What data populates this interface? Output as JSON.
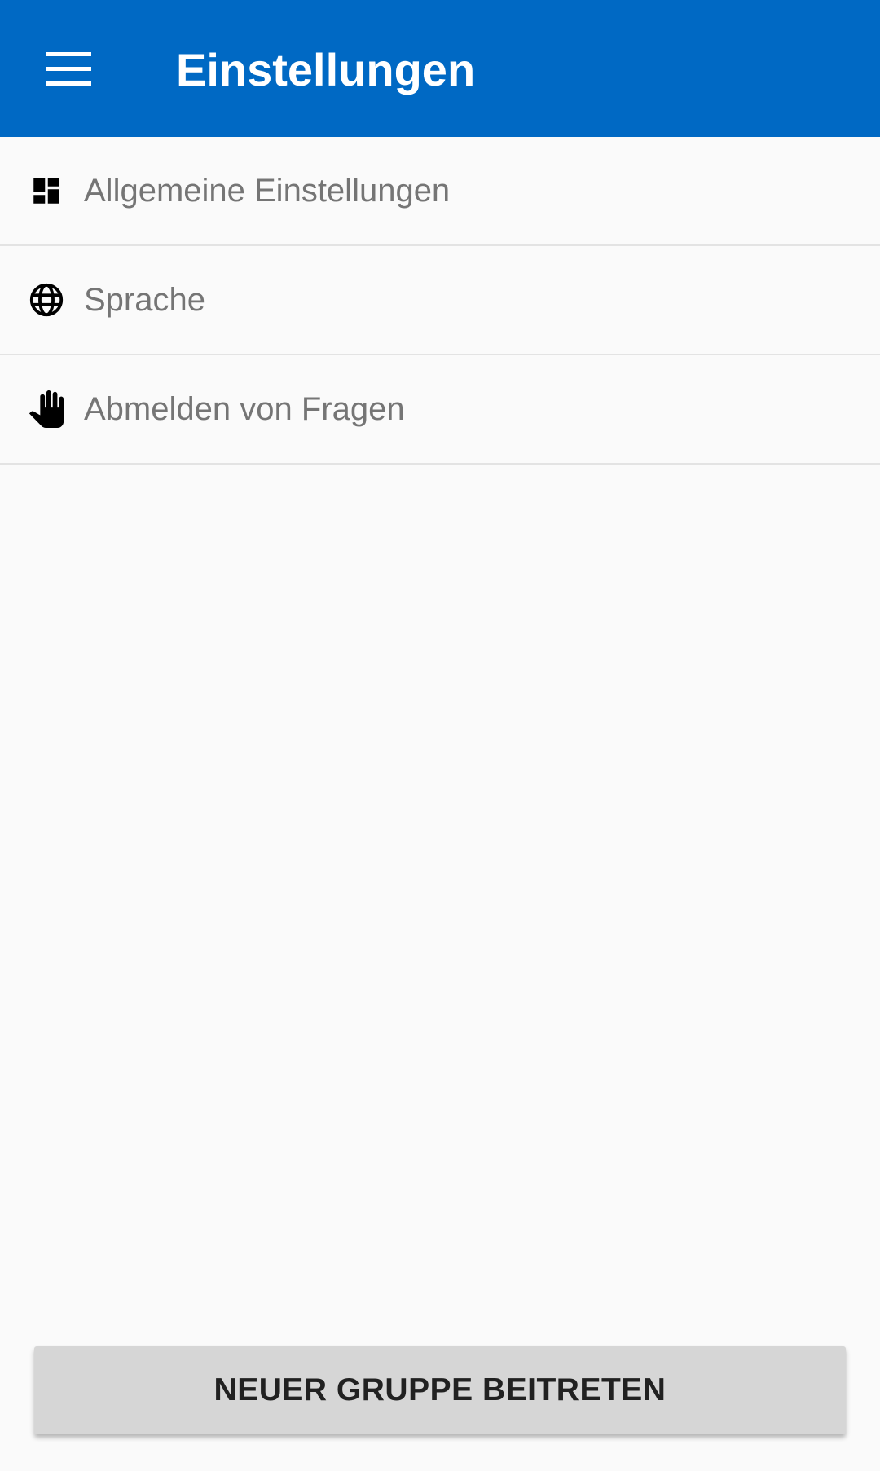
{
  "header": {
    "title": "Einstellungen",
    "menu_icon": "hamburger-menu-icon",
    "background_color": "#0069c4"
  },
  "settings_list": [
    {
      "label": "Allgemeine Einstellungen",
      "icon": "dashboard-icon"
    },
    {
      "label": "Sprache",
      "icon": "globe-icon"
    },
    {
      "label": "Abmelden von Fragen",
      "icon": "hand-icon"
    }
  ],
  "footer": {
    "join_button_label": "NEUER GRUPPE BEITRETEN"
  }
}
